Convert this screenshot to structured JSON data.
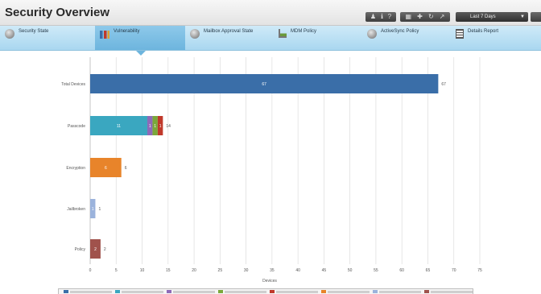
{
  "header": {
    "title": "Security Overview",
    "range_select": "Last 7 Days"
  },
  "tabs": [
    {
      "label": "Security State",
      "icon": "globe-icon",
      "active": false
    },
    {
      "label": "Vulnerability",
      "icon": "bar-chart-icon",
      "active": true
    },
    {
      "label": "Mailbox Approval State",
      "icon": "globe-icon",
      "active": false
    },
    {
      "label": "MDM Policy",
      "icon": "chart-icon",
      "active": false
    },
    {
      "label": "ActiveSync Policy",
      "icon": "globe-icon",
      "active": false
    },
    {
      "label": "Details Report",
      "icon": "document-icon",
      "active": false
    }
  ],
  "colors": {
    "tab_bg": "#a9d7f0",
    "active_tab": "#6db5de",
    "grid": "#dcdcdc"
  },
  "chart_data": {
    "type": "bar",
    "orientation": "horizontal",
    "stacked": true,
    "categories": [
      "Total Devices",
      "Passcode",
      "Encryption",
      "Jailbroken",
      "Policy"
    ],
    "xlabel": "Devices",
    "xlim": [
      0,
      75
    ],
    "xticks": [
      0,
      5,
      10,
      15,
      20,
      25,
      30,
      35,
      40,
      45,
      50,
      55,
      60,
      65,
      70,
      75
    ],
    "grid": true,
    "legend_position": "bottom",
    "series": [
      {
        "color": "#3a6ea8",
        "values": [
          67,
          0,
          0,
          0,
          0
        ],
        "labels": [
          "67",
          "",
          "",
          "",
          ""
        ]
      },
      {
        "color": "#3aa7c0",
        "values": [
          0,
          11,
          0,
          0,
          0
        ],
        "labels": [
          "",
          "11",
          "",
          "",
          ""
        ]
      },
      {
        "color": "#8e6ab8",
        "values": [
          0,
          1,
          0,
          0,
          0
        ],
        "labels": [
          "",
          "1",
          "",
          "",
          ""
        ]
      },
      {
        "color": "#7aa83a",
        "values": [
          0,
          1,
          0,
          0,
          0
        ],
        "labels": [
          "",
          "1",
          "",
          "",
          ""
        ]
      },
      {
        "color": "#c0392b",
        "values": [
          0,
          1,
          0,
          0,
          0
        ],
        "labels": [
          "",
          "1",
          "",
          "",
          ""
        ]
      },
      {
        "color": "#e8842a",
        "values": [
          0,
          0,
          6,
          0,
          0
        ],
        "labels": [
          "",
          "",
          "6",
          "",
          ""
        ]
      },
      {
        "color": "#9bb3dc",
        "values": [
          0,
          0,
          0,
          1,
          0
        ],
        "labels": [
          "",
          "",
          "",
          "1",
          ""
        ]
      },
      {
        "color": "#a0524c",
        "values": [
          0,
          0,
          0,
          0,
          2
        ],
        "labels": [
          "",
          "",
          "",
          "",
          "2"
        ]
      }
    ],
    "totals": [
      "67",
      "14",
      "6",
      "1",
      "2"
    ]
  }
}
